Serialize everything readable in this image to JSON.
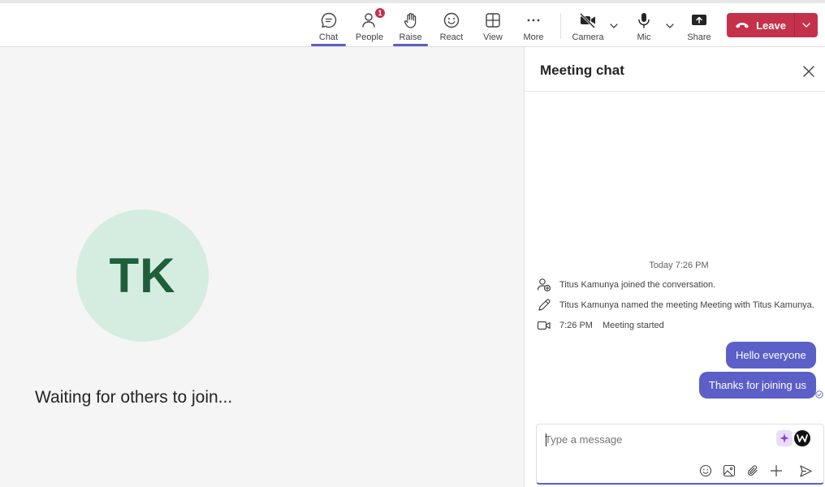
{
  "toolbar": {
    "chat_label": "Chat",
    "people_label": "People",
    "people_badge": "1",
    "raise_label": "Raise",
    "react_label": "React",
    "view_label": "View",
    "more_label": "More",
    "camera_label": "Camera",
    "mic_label": "Mic",
    "share_label": "Share",
    "leave_label": "Leave",
    "accent_color": "#5b5fc7",
    "leave_color": "#c4314b"
  },
  "stage": {
    "avatar_initials": "TK",
    "avatar_color": "#d4ede0",
    "waiting_text": "Waiting for others to join..."
  },
  "chat": {
    "title": "Meeting chat",
    "timestamp": "Today 7:26 PM",
    "events": [
      {
        "icon": "person-add-icon",
        "text": "Titus Kamunya joined the conversation."
      },
      {
        "icon": "pencil-icon",
        "text": "Titus Kamunya named the meeting Meeting with Titus Kamunya."
      },
      {
        "icon": "video-icon",
        "time": "7:26 PM",
        "text": "Meeting started"
      }
    ],
    "messages": [
      {
        "text": "Hello everyone"
      },
      {
        "text": "Thanks for joining us"
      }
    ],
    "compose": {
      "placeholder": "Type a message"
    }
  }
}
